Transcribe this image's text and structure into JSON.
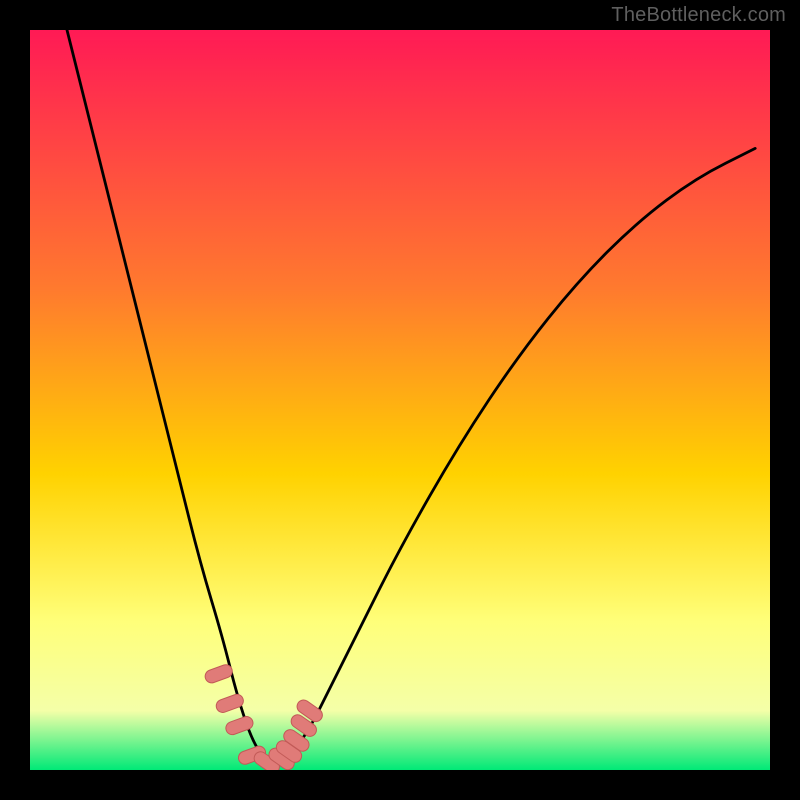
{
  "watermark": "TheBottleneck.com",
  "colors": {
    "frame_bg": "#000000",
    "grad_top": "#ff1a55",
    "grad_mid1": "#ff7a2e",
    "grad_mid2": "#ffd200",
    "grad_mid3": "#ffff7a",
    "grad_mid4": "#f4ffa8",
    "grad_bottom": "#00e977",
    "curve": "#000000",
    "marker_fill": "#e07b78",
    "marker_stroke": "#c25a57"
  },
  "chart_data": {
    "type": "line",
    "title": "",
    "xlabel": "",
    "ylabel": "",
    "xlim": [
      0,
      100
    ],
    "ylim": [
      0,
      100
    ],
    "note": "Axes not shown in image; x/y normalized to plot interior. y=0 is the green baseline (no bottleneck), y=100 is the red top (maximum bottleneck). Curve is an estimated V-shaped bottleneck profile with minimum near x≈32.",
    "series": [
      {
        "name": "bottleneck-curve",
        "x": [
          5,
          8,
          12,
          16,
          20,
          23,
          26,
          28,
          30,
          32,
          34,
          36,
          38,
          40,
          44,
          50,
          58,
          66,
          74,
          82,
          90,
          98
        ],
        "y": [
          100,
          88,
          72,
          56,
          40,
          28,
          18,
          10,
          4,
          1,
          1,
          3,
          6,
          10,
          18,
          30,
          44,
          56,
          66,
          74,
          80,
          84
        ]
      },
      {
        "name": "markers",
        "x": [
          25.5,
          27.0,
          28.3,
          30.0,
          32.0,
          34.0,
          35.0,
          36.0,
          37.0,
          37.8
        ],
        "y": [
          13.0,
          9.0,
          6.0,
          2.0,
          1.0,
          1.5,
          2.5,
          4.0,
          6.0,
          8.0
        ]
      }
    ]
  }
}
